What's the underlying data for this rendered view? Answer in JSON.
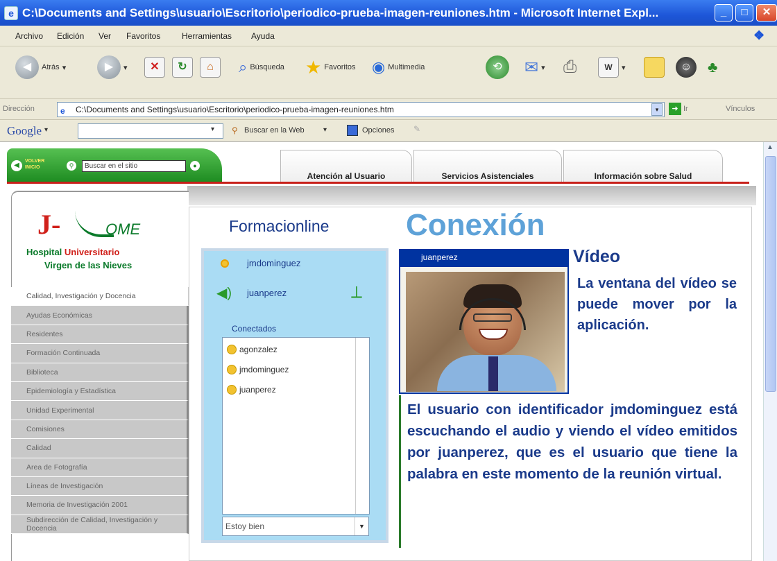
{
  "window": {
    "title": "C:\\Documents and Settings\\usuario\\Escritorio\\periodico-prueba-imagen-reuniones.htm - Microsoft Internet Expl...",
    "min": "_",
    "max": "□",
    "close": "✕"
  },
  "menu": [
    "Archivo",
    "Edición",
    "Ver",
    "Favoritos",
    "Herramientas",
    "Ayuda"
  ],
  "toolbar": {
    "back": "Atrás",
    "search": "Búsqueda",
    "favorites": "Favoritos",
    "multimedia": "Multimedia"
  },
  "address": {
    "label": "Dirección",
    "value": "C:\\Documents and Settings\\usuario\\Escritorio\\periodico-prueba-imagen-reuniones.htm",
    "go": "Ir",
    "links": "Vínculos"
  },
  "google": {
    "logo": "Google",
    "search_web": "Buscar en la Web",
    "options": "Opciones"
  },
  "site": {
    "back_button": "VOLVER INICIO",
    "search_placeholder": "Buscar en el sitio",
    "tabs": [
      "Atención al Usuario",
      "Servicios Asistenciales",
      "Información sobre Salud"
    ],
    "logo_ome": "OME",
    "logo_line1_a": "Hospital ",
    "logo_line1_b": "Universitario",
    "logo_line2": "Virgen de las Nieves",
    "menu": [
      "Calidad, Investigación y Docencia",
      "Ayudas Económicas",
      "Residentes",
      "Formación Continuada",
      "Biblioteca",
      "Epidemiología y Estadística",
      "Unidad Experimental",
      "Comisiones",
      "Calidad",
      "Area de Fotografía",
      "Líneas de Investigación",
      "Memoria de Investigación 2001",
      "Subdirección de Calidad, Investigación y Docencia"
    ]
  },
  "chat": {
    "title": "Formacionline",
    "user1": "jmdominguez",
    "user2": "juanperez",
    "connected_label": "Conectados",
    "connected": [
      "agonzalez",
      "jmdominguez",
      "juanperez"
    ],
    "status": "Estoy bien"
  },
  "main": {
    "heading": "Conexión",
    "video_user": "juanperez",
    "video_title": "Vídeo",
    "video_text": "La ventana del vídeo se puede mover por la aplicación.",
    "body": "El usuario con identificador jmdominguez está escuchando el audio y viendo el vídeo emitidos por juanperez, que es el usuario que tiene la palabra en este momento de la reunión virtual."
  }
}
